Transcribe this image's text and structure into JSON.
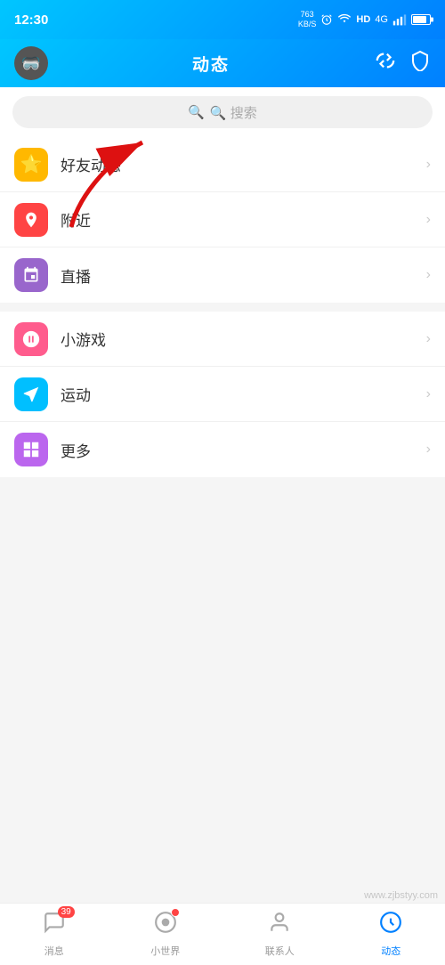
{
  "statusBar": {
    "time": "12:30",
    "speed": "763\nKB/S"
  },
  "header": {
    "title": "动态",
    "avatarEmoji": "🥽"
  },
  "search": {
    "placeholder": "🔍 搜索"
  },
  "menuGroups": [
    {
      "id": "group1",
      "items": [
        {
          "id": "friends",
          "label": "好友动态",
          "iconBg": "icon-yellow",
          "icon": "⭐"
        },
        {
          "id": "nearby",
          "label": "附近",
          "iconBg": "icon-red",
          "icon": "📍"
        },
        {
          "id": "live",
          "label": "直播",
          "iconBg": "icon-purple",
          "icon": "🎮"
        }
      ]
    },
    {
      "id": "group2",
      "items": [
        {
          "id": "minigame",
          "label": "小游戏",
          "iconBg": "icon-pink",
          "icon": "👤"
        },
        {
          "id": "sport",
          "label": "运动",
          "iconBg": "icon-cyan",
          "icon": "✈"
        },
        {
          "id": "more",
          "label": "更多",
          "iconBg": "icon-purple2",
          "icon": "⊞"
        }
      ]
    }
  ],
  "bottomNav": [
    {
      "id": "messages",
      "label": "消息",
      "icon": "💬",
      "badge": "39",
      "active": false
    },
    {
      "id": "world",
      "label": "小世界",
      "icon": "◯",
      "dot": true,
      "active": false
    },
    {
      "id": "contacts",
      "label": "联系人",
      "icon": "👤",
      "active": false
    },
    {
      "id": "discover",
      "label": "动态",
      "icon": "🔵",
      "active": true
    }
  ],
  "watermark": "www.zjbstyy.com"
}
